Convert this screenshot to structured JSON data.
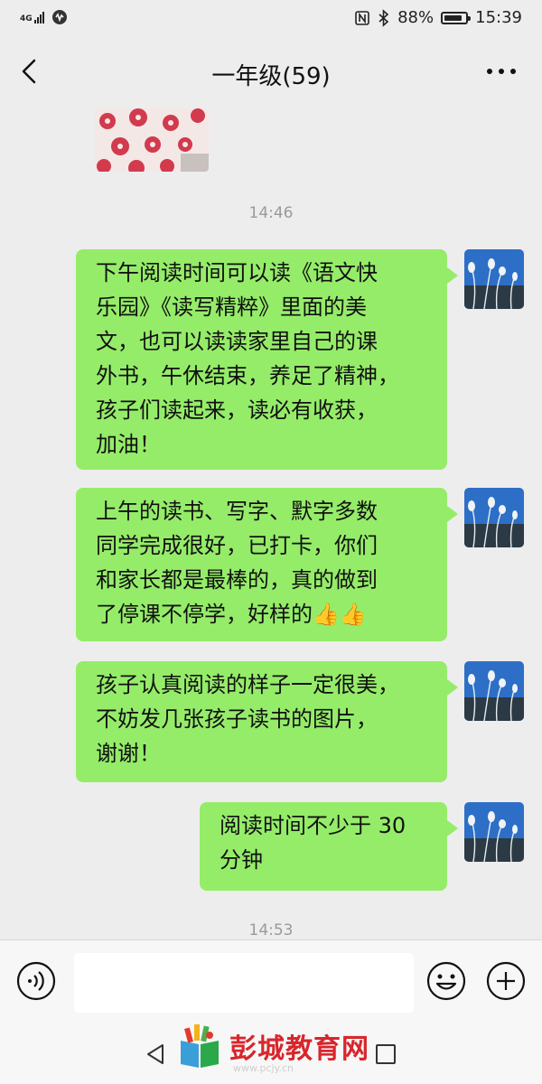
{
  "status_bar": {
    "network": "4G",
    "battery": "88%",
    "battery_level": 0.88,
    "time": "15:39"
  },
  "header": {
    "title": "一年级(59)"
  },
  "messages": [
    {
      "type": "image",
      "description_icon": "flower-pattern-image"
    },
    {
      "type": "time",
      "text": "14:46"
    },
    {
      "type": "text",
      "sender": "self",
      "lines": [
        "下午阅读时间可以读《语文快",
        "乐园》《读写精粹》里面的美",
        "文，也可以读读家里自己的课",
        "外书，午休结束，养足了精神，",
        "孩子们读起来，读必有收获，",
        "加油！"
      ]
    },
    {
      "type": "text",
      "sender": "self",
      "lines": [
        "上午的读书、写字、默字多数",
        "同学完成很好，已打卡，你们",
        "和家长都是最棒的，真的做到",
        "了停课不停学，好样的👍👍"
      ]
    },
    {
      "type": "text",
      "sender": "self",
      "lines": [
        "孩子认真阅读的样子一定很美，",
        "不妨发几张孩子读书的图片，",
        "谢谢！"
      ]
    },
    {
      "type": "text",
      "sender": "self",
      "lines": [
        "阅读时间不少于 30",
        "分钟"
      ]
    },
    {
      "type": "time",
      "text": "14:53"
    }
  ],
  "watermark": {
    "text": "彭城教育网",
    "url": "www.pcjy.cn"
  },
  "icons": {
    "back": "chevron-left-icon",
    "more": "more-dots-icon",
    "voice": "voice-icon",
    "emoji": "emoji-icon",
    "plus": "plus-icon"
  },
  "colors": {
    "bubble": "#95ec69",
    "background": "#ededed",
    "watermark": "#d8262c"
  }
}
